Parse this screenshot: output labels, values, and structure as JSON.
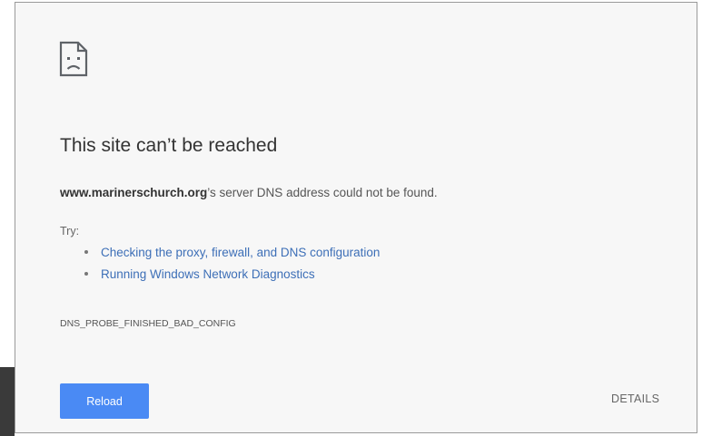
{
  "error_page": {
    "icon": "sad-page-icon",
    "heading": "This site can’t be reached",
    "message": {
      "domain": "www.marinerschurch.org",
      "suffix": "’s server DNS address could not be found."
    },
    "try_label": "Try:",
    "suggestions": [
      {
        "label": "Checking the proxy, firewall, and DNS configuration"
      },
      {
        "label": "Running Windows Network Diagnostics"
      }
    ],
    "error_code": "DNS_PROBE_FINISHED_BAD_CONFIG",
    "reload_label": "Reload",
    "details_label": "DETAILS"
  },
  "colors": {
    "page_background": "#f7f7f7",
    "heading_text": "#333333",
    "link": "#3d6fb7",
    "reload_button": "#4a8af4",
    "reload_text": "#ffffff",
    "details_text": "#666666"
  }
}
